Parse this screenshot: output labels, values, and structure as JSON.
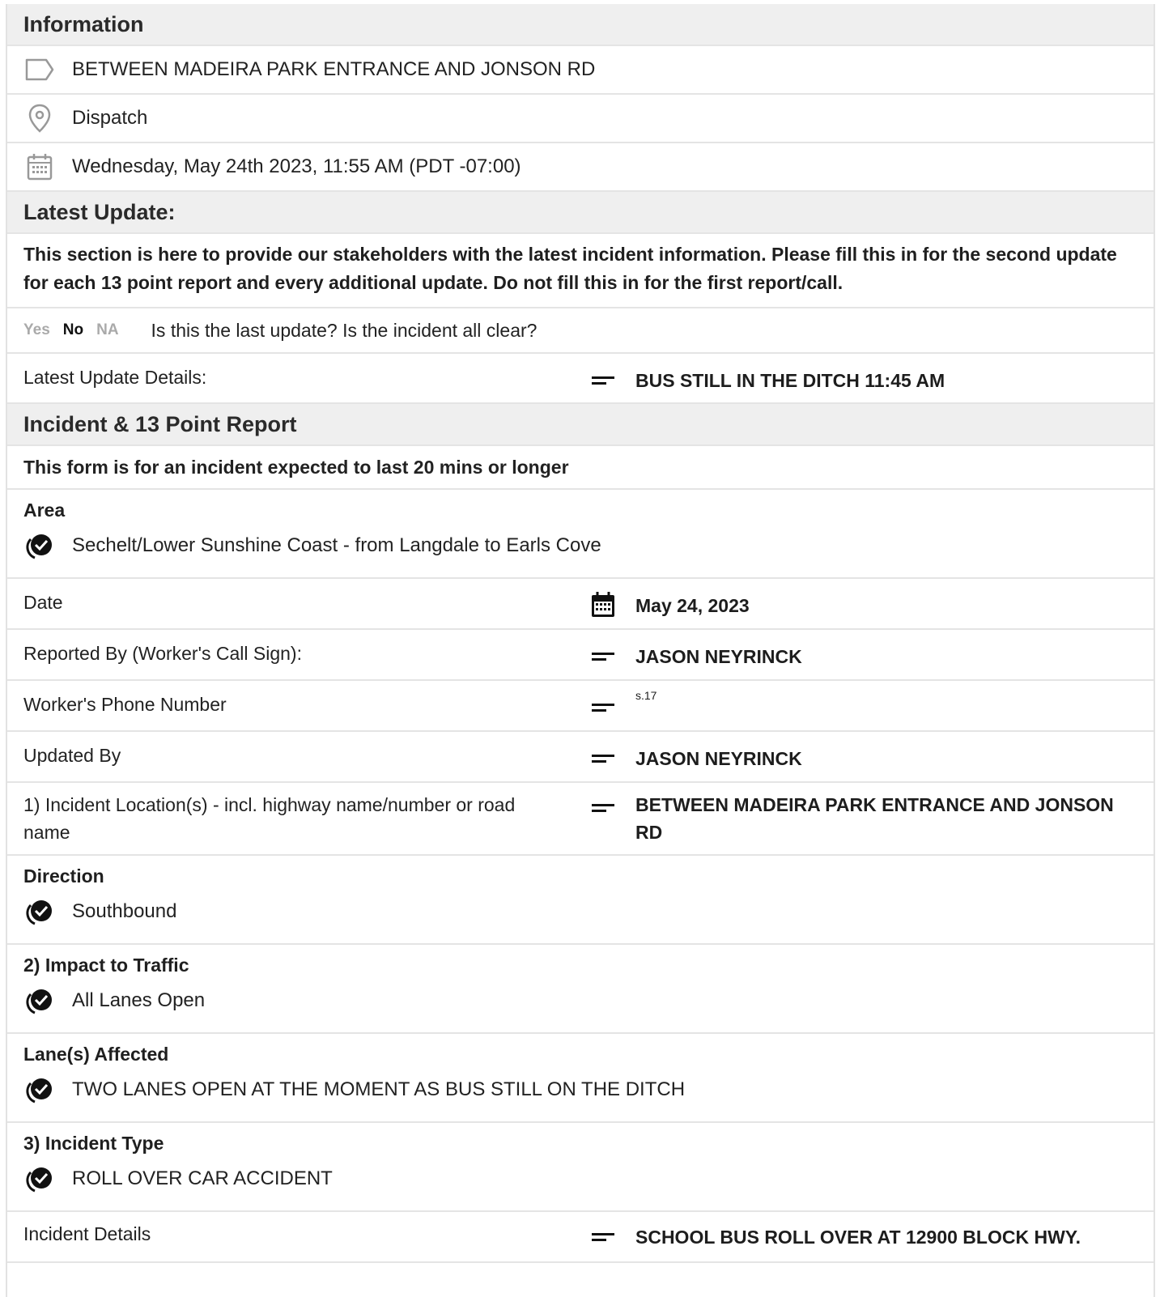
{
  "info": {
    "title": "Information",
    "location": "BETWEEN MADEIRA PARK ENTRANCE AND JONSON RD",
    "place": "Dispatch",
    "datetime": "Wednesday, May 24th 2023, 11:55 AM (PDT -07:00)"
  },
  "latest": {
    "title": "Latest Update:",
    "description": "This section is here to provide our stakeholders with the latest incident information. Please fill this in for the second update for each 13 point report and every additional update. Do not fill this in for the first report/call.",
    "yes": "Yes",
    "no": "No",
    "na": "NA",
    "selected": "No",
    "question": "Is this the last update? Is the incident all clear?",
    "details_label": "Latest Update Details:",
    "details_value": "BUS STILL IN THE DITCH 11:45 AM"
  },
  "incident": {
    "title": "Incident & 13 Point Report",
    "note": "This form is for an incident expected to last 20 mins or longer",
    "area_label": "Area",
    "area_value": "Sechelt/Lower Sunshine Coast - from Langdale to Earls Cove",
    "date_label": "Date",
    "date_value": "May 24, 2023",
    "reported_label": "Reported By (Worker's Call Sign):",
    "reported_value": "JASON NEYRINCK",
    "phone_label": "Worker's Phone Number",
    "phone_value": "s.17",
    "updated_label": "Updated By",
    "updated_value": "JASON NEYRINCK",
    "location_label": "1) Incident Location(s) - incl. highway name/number or road name",
    "location_value": "BETWEEN MADEIRA PARK ENTRANCE AND JONSON RD",
    "direction_label": "Direction",
    "direction_value": "Southbound",
    "impact_label": "2) Impact to Traffic",
    "impact_value": "All Lanes Open",
    "lanes_label": "Lane(s) Affected",
    "lanes_value": "TWO LANES OPEN AT THE MOMENT AS BUS STILL ON THE DITCH",
    "type_label": "3) Incident Type",
    "type_value": "ROLL OVER CAR ACCIDENT",
    "details_label": "Incident Details",
    "details_value": "SCHOOL BUS ROLL OVER AT 12900 BLOCK HWY."
  }
}
